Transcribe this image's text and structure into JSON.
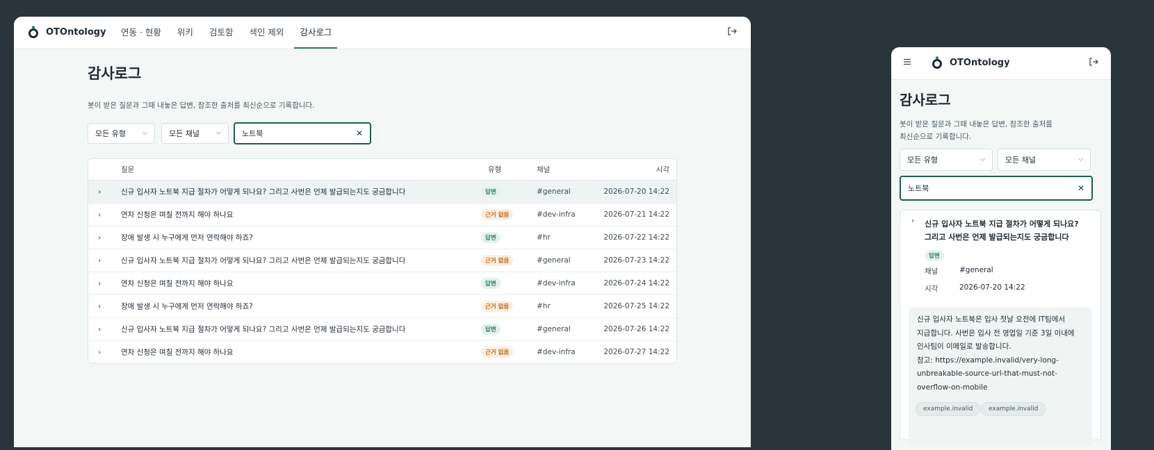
{
  "app": {
    "name": "OTOntology"
  },
  "nav": {
    "items": [
      {
        "label": "연동 · 현황"
      },
      {
        "label": "위키"
      },
      {
        "label": "검토함"
      },
      {
        "label": "색인 제외"
      },
      {
        "label": "감사로그"
      }
    ]
  },
  "page": {
    "title": "감사로그",
    "description": "봇이 받은 질문과 그때 내놓은 답변, 참조한 출처를 최신순으로 기록합니다."
  },
  "filters": {
    "type_select": "모든 유형",
    "channel_select": "모든 채널",
    "search_value": "노트북"
  },
  "table": {
    "headers": {
      "question": "질문",
      "type": "유형",
      "channel": "채널",
      "time": "시각"
    },
    "rows": [
      {
        "question": "신규 입사자 노트북 지급 절차가 어떻게 되나요? 그리고 사번은 언제 발급되는지도 궁금합니다",
        "type": "답변",
        "status": "ok",
        "channel": "#general",
        "time": "2026-07-20 14:22"
      },
      {
        "question": "연차 신청은 며칠 전까지 해야 하나요",
        "type": "근거 없음",
        "status": "none",
        "channel": "#dev-infra",
        "time": "2026-07-21 14:22"
      },
      {
        "question": "장애 발생 시 누구에게 먼저 연락해야 하죠?",
        "type": "답변",
        "status": "ok",
        "channel": "#hr",
        "time": "2026-07-22 14:22"
      },
      {
        "question": "신규 입사자 노트북 지급 절차가 어떻게 되나요? 그리고 사번은 언제 발급되는지도 궁금합니다",
        "type": "근거 없음",
        "status": "none",
        "channel": "#general",
        "time": "2026-07-23 14:22"
      },
      {
        "question": "연차 신청은 며칠 전까지 해야 하나요",
        "type": "답변",
        "status": "ok",
        "channel": "#dev-infra",
        "time": "2026-07-24 14:22"
      },
      {
        "question": "장애 발생 시 누구에게 먼저 연락해야 하죠?",
        "type": "근거 없음",
        "status": "none",
        "channel": "#hr",
        "time": "2026-07-25 14:22"
      },
      {
        "question": "신규 입사자 노트북 지급 절차가 어떻게 되나요? 그리고 사번은 언제 발급되는지도 궁금합니다",
        "type": "답변",
        "status": "ok",
        "channel": "#general",
        "time": "2026-07-26 14:22"
      },
      {
        "question": "연차 신청은 며칠 전까지 해야 하나요",
        "type": "근거 없음",
        "status": "none",
        "channel": "#dev-infra",
        "time": "2026-07-27 14:22"
      }
    ]
  },
  "mobile": {
    "description_line1": "봇이 받은 질문과 그때 내놓은 답변, 참조한 출처를",
    "description_line2": "최신순으로 기록합니다.",
    "card": {
      "question_line1": "신규 입사자 노트북 지급 절차가 어떻게 되나요?",
      "question_line2": "그리고 사번은 언제 발급되는지도 궁금합니다",
      "type": "답변",
      "channel_label": "채널",
      "channel_value": "#general",
      "time_label": "시각",
      "time_value": "2026-07-20 14:22",
      "answer_lines": [
        "신규 입사자 노트북은 입사 첫날 오전에 IT팀에서",
        "지급합니다. 사번은 입사 전 영업일 기준 3일 이내에",
        "인사팀이 이메일로 발송합니다.",
        "참고: https://example.invalid/very-long-",
        "unbreakable-source-url-that-must-not-",
        "overflow-on-mobile"
      ],
      "sources": [
        "example.invalid",
        "example.invalid"
      ]
    }
  },
  "colors": {
    "accent": "#2c7a63",
    "background": "#2a343b",
    "badge_ok": "#2c7a63",
    "badge_none": "#c36a21"
  },
  "icons": {
    "logout": "logout-icon",
    "menu": "hamburger-menu-icon",
    "clear": "clear-icon",
    "chevron_down": "chevron-down-icon",
    "chevron_right": "chevron-right-icon"
  }
}
